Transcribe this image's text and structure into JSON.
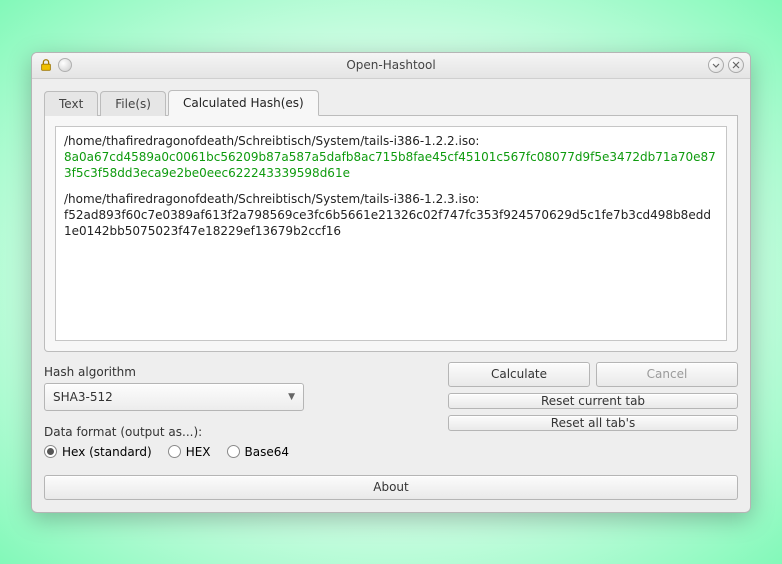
{
  "window": {
    "title": "Open-Hashtool"
  },
  "tabs": {
    "text": "Text",
    "files": "File(s)",
    "calculated": "Calculated Hash(es)"
  },
  "results": [
    {
      "path": "/home/thafiredragonofdeath/Schreibtisch/System/tails-i386-1.2.2.iso:",
      "hash": "8a0a67cd4589a0c0061bc56209b87a587a5dafb8ac715b8fae45cf45101c567fc08077d9f5e3472db71a70e873f5c3f58dd3eca9e2be0eec622243339598d61e",
      "verified": true
    },
    {
      "path": "/home/thafiredragonofdeath/Schreibtisch/System/tails-i386-1.2.3.iso:",
      "hash": "f52ad893f60c7e0389af613f2a798569ce3fc6b5661e21326c02f747fc353f924570629d5c1fe7b3cd498b8edd1e0142bb5075023f47e18229ef13679b2ccf16",
      "verified": false
    }
  ],
  "algo": {
    "label": "Hash algorithm",
    "value": "SHA3-512"
  },
  "format": {
    "label": "Data format (output as...):",
    "options": {
      "hex_std": "Hex (standard)",
      "hex_upper": "HEX",
      "base64": "Base64"
    },
    "selected": "hex_std"
  },
  "buttons": {
    "calculate": "Calculate",
    "cancel": "Cancel",
    "reset_current": "Reset current tab",
    "reset_all": "Reset all tab's",
    "about": "About"
  }
}
